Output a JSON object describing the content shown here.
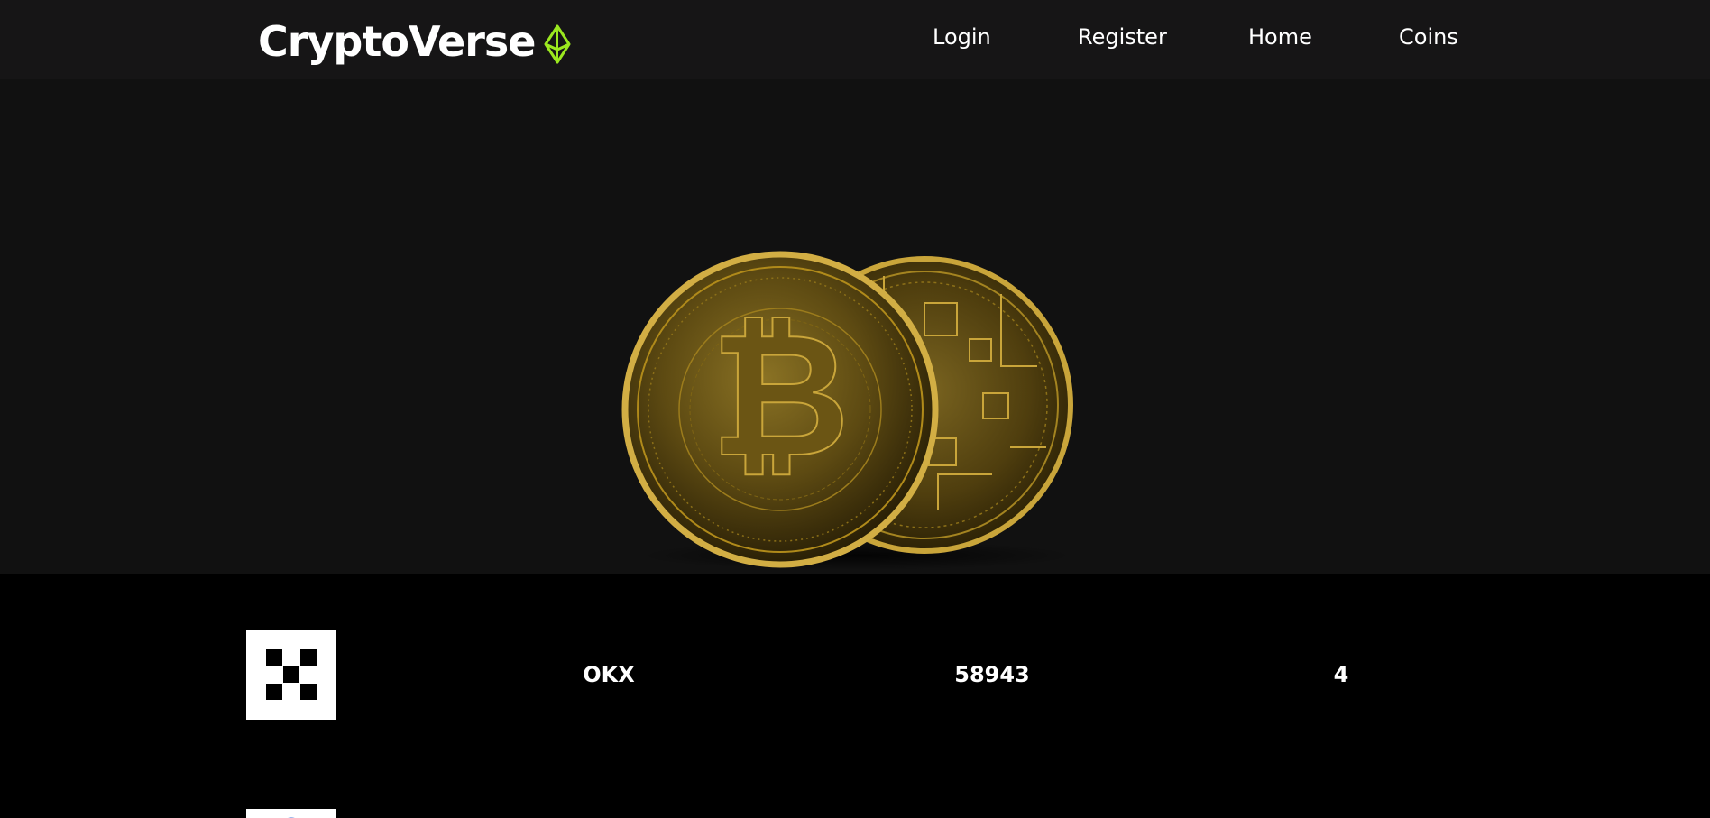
{
  "brand": {
    "name": "CryptoVerse",
    "icon": "ethereum-diamond-icon",
    "accent": "#9be81f"
  },
  "nav": {
    "links": [
      {
        "label": "Login"
      },
      {
        "label": "Register"
      },
      {
        "label": "Home"
      },
      {
        "label": "Coins"
      }
    ]
  },
  "hero": {
    "image": "bitcoin-coins-illustration",
    "coin_color": "#b08a1a"
  },
  "coins": [
    {
      "logo": "okx-logo-icon",
      "name": "OKX",
      "value": "58943",
      "rank": "4"
    },
    {
      "logo": "coin-logo-icon",
      "name": "",
      "value": "",
      "rank": ""
    }
  ]
}
